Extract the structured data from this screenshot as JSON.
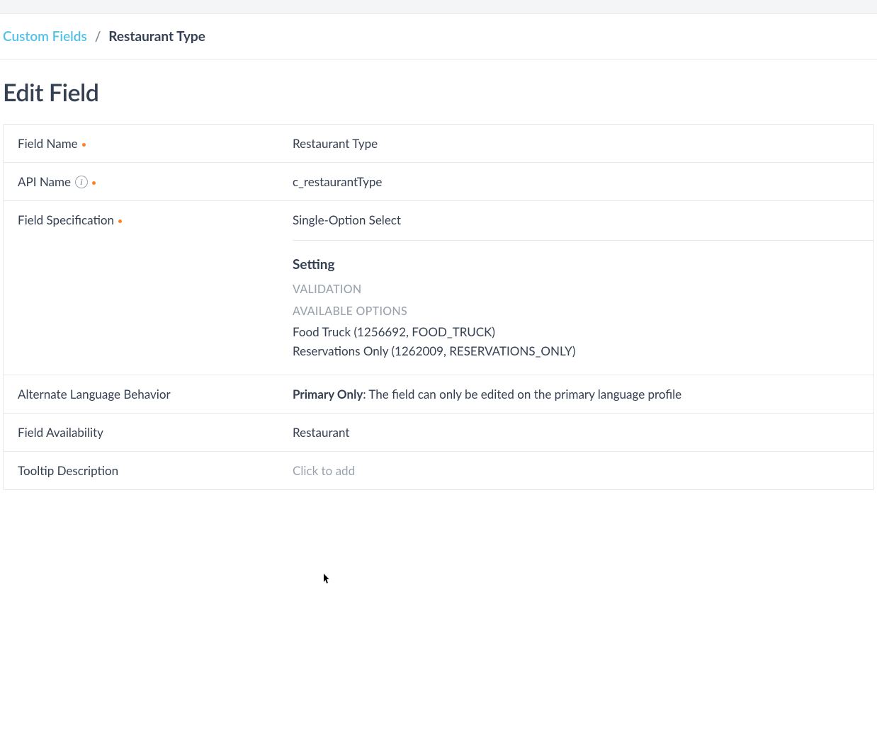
{
  "breadcrumb": {
    "parent": "Custom Fields",
    "separator": "/",
    "current": "Restaurant Type"
  },
  "page": {
    "title": "Edit Field"
  },
  "rows": {
    "field_name": {
      "label": "Field Name",
      "value": "Restaurant Type"
    },
    "api_name": {
      "label": "API Name",
      "value": "c_restaurantType"
    },
    "field_specification": {
      "label": "Field Specification",
      "type_value": "Single-Option Select",
      "setting_header": "Setting",
      "validation_label": "VALIDATION",
      "available_options_label": "AVAILABLE OPTIONS",
      "options": [
        "Food Truck (1256692, FOOD_TRUCK)",
        "Reservations Only (1262009, RESERVATIONS_ONLY)"
      ]
    },
    "alt_language": {
      "label": "Alternate Language Behavior",
      "value_bold": "Primary Only",
      "value_rest": ": The field can only be edited on the primary language profile"
    },
    "field_availability": {
      "label": "Field Availability",
      "value": "Restaurant"
    },
    "tooltip_description": {
      "label": "Tooltip Description",
      "placeholder": "Click to add"
    }
  }
}
